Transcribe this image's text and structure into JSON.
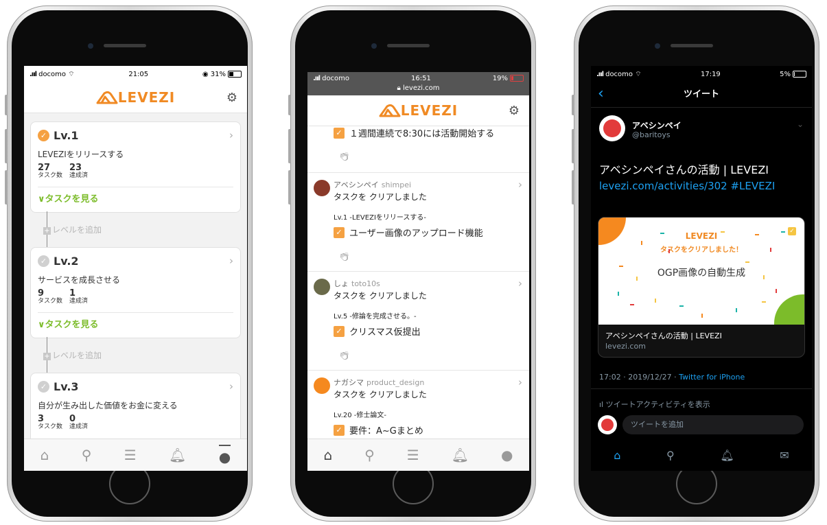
{
  "phone1": {
    "status": {
      "carrier": "docomo",
      "time": "21:05",
      "battery": "31%"
    },
    "logo": "LEVEZI",
    "levels": [
      {
        "level": "Lv.1",
        "title": "LEVEZIをリリースする",
        "tasks": "27",
        "tasks_label": "タスク数",
        "done": "23",
        "done_label": "達成済",
        "link": "∨タスクを見る",
        "done_check": true
      },
      {
        "level": "Lv.2",
        "title": "サービスを成長させる",
        "tasks": "9",
        "tasks_label": "タスク数",
        "done": "1",
        "done_label": "達成済",
        "link": "∨タスクを見る",
        "done_check": false
      },
      {
        "level": "Lv.3",
        "title": "自分が生み出した価値をお金に変える",
        "tasks": "3",
        "tasks_label": "タスク数",
        "done": "0",
        "done_label": "達成済",
        "link": "",
        "done_check": false
      }
    ],
    "add_level": "レベルを追加"
  },
  "phone2": {
    "status": {
      "carrier": "docomo",
      "time": "16:51",
      "battery": "19%",
      "url": "levezi.com"
    },
    "logo": "LEVEZI",
    "top_task": "１週間連続で8:30には活動開始する",
    "activities": [
      {
        "user": "アベシンペイ",
        "handle": "shimpei",
        "action": "タスクを クリアしました",
        "level": "Lv.1 -LEVEZIをリリースする-",
        "task": "ユーザー画像のアップロード機能"
      },
      {
        "user": "しょ",
        "handle": "toto10s",
        "action": "タスクを クリアしました",
        "level": "Lv.5 -修論を完成させる。-",
        "task": "クリスマス仮提出"
      },
      {
        "user": "ナガシマ",
        "handle": "product_design",
        "action": "タスクを クリアしました",
        "level": "Lv.20 -修士論文-",
        "task": "要件：A~Gまとめ"
      }
    ]
  },
  "phone3": {
    "status": {
      "carrier": "docomo",
      "time": "17:19",
      "battery": "5%"
    },
    "header": "ツイート",
    "author": {
      "name": "アベシンペイ",
      "handle": "@baritoys"
    },
    "tweet_text": "アベシンペイさんの活動 | LEVEZI",
    "tweet_link": "levezi.com/activities/302 #LEVEZI",
    "card": {
      "logo": "LEVEZI",
      "banner": "タスクをクリアしました！",
      "image_text": "OGP画像の自動生成",
      "title": "アベシンペイさんの活動 | LEVEZI",
      "domain": "levezi.com"
    },
    "meta_date": "17:02 · 2019/12/27 · ",
    "meta_client": "Twitter for iPhone",
    "activity": "ツイートアクティビティを表示",
    "reply_placeholder": "ツイートを追加"
  },
  "colors": {
    "brand": "#f08a24",
    "green": "#7cbc2a",
    "twitter_blue": "#1da1f2"
  }
}
